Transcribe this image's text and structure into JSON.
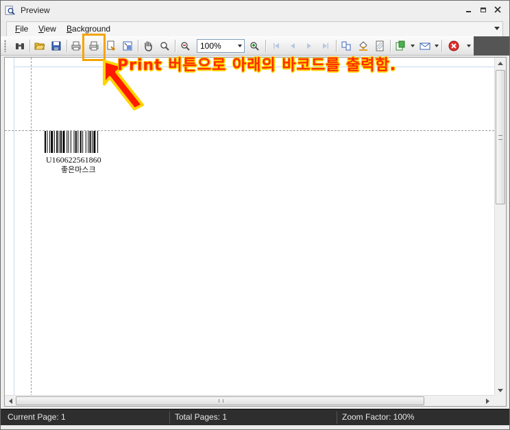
{
  "window": {
    "title": "Preview"
  },
  "menu": {
    "items": [
      {
        "label": "File",
        "mnemonic": "F",
        "rest": "ile"
      },
      {
        "label": "View",
        "mnemonic": "V",
        "rest": "iew"
      },
      {
        "label": "Background",
        "mnemonic": "B",
        "rest": "ackground"
      }
    ]
  },
  "toolbar": {
    "zoom_value": "100%",
    "highlight_color": "#f5a400"
  },
  "document": {
    "barcode_number": "U160622561860",
    "barcode_name": "좋은마스크"
  },
  "annotation": {
    "text": "Print 버튼으로 아래의 바코드를 출력함.",
    "text_color": "#ff2a00",
    "outline_color": "#ffd400",
    "arrow_color": "#ff1a00"
  },
  "status": {
    "current_page": "Current Page: 1",
    "total_pages": "Total Pages: 1",
    "zoom_factor": "Zoom Factor: 100%"
  }
}
